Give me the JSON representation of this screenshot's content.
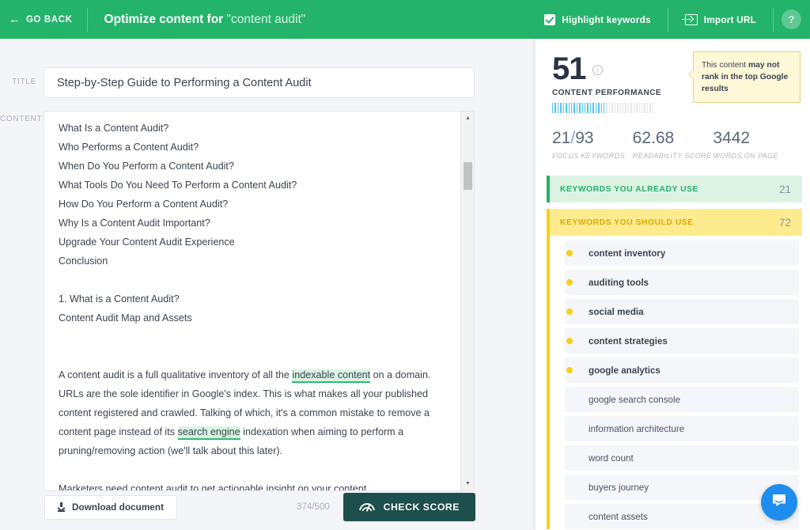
{
  "header": {
    "go_back": "GO BACK",
    "back_icon": "arrow-left-icon",
    "title_prefix": "Optimize content for",
    "title_keyword": "\"content audit\"",
    "highlight_keywords": "Highlight keywords",
    "highlight_checked": true,
    "import_url": "Import URL",
    "help": "?",
    "accent": "#23b36b"
  },
  "editor": {
    "title_label": "TITLE",
    "title_value": "Step-by-Step Guide to Performing a Content Audit",
    "content_label": "CONTENT",
    "lines": [
      "What Is a Content Audit?",
      "Who Performs a Content Audit?",
      "When Do You Perform a Content Audit?",
      "What Tools Do You Need To Perform a Content Audit?",
      "How Do You Perform a Content Audit?",
      "Why Is a Content Audit Important?",
      "Upgrade Your Content Audit Experience",
      "Conclusion"
    ],
    "lines2": [
      "1. What is a Content Audit?",
      "Content Audit Map and Assets"
    ],
    "para1_a": "A content audit is a full qualitative inventory of all the ",
    "para1_hl1": "indexable content",
    "para1_b": " on a domain. URLs are the sole identifier in Google's index. This is what makes all your published content registered and crawled. Talking of which, it's a common mistake to remove a content page instead of its ",
    "para1_hl2": "search engine",
    "para1_c": " indexation when aiming to perform a pruning/removing action (we'll talk about this later).",
    "para2": "Marketers need content audit to get actionable insight on your content",
    "download_label": "Download document",
    "char_count": "374/500",
    "check_score_label": "CHECK SCORE"
  },
  "panel": {
    "score": "51",
    "score_caption": "CONTENT PERFORMANCE",
    "gauge_total": 38,
    "gauge_filled": 20,
    "gauge_color": "#4fc3f7",
    "tooltip_plain": "This content ",
    "tooltip_bold": "may not rank in the top Google results",
    "stats": [
      {
        "value": "21/93",
        "label": "FOCUS KEYWORDS"
      },
      {
        "value": "62.68",
        "label": "READABILITY SCORE"
      },
      {
        "value": "3442",
        "label": "WORDS ON PAGE"
      }
    ],
    "section_already": {
      "label": "KEYWORDS YOU ALREADY USE",
      "count": "21",
      "color": "#27b06b"
    },
    "section_should": {
      "label": "KEYWORDS YOU SHOULD USE",
      "count": "72",
      "color": "#e0a800"
    },
    "keywords": [
      {
        "text": "content inventory",
        "dot": true
      },
      {
        "text": "auditing tools",
        "dot": true
      },
      {
        "text": "social media",
        "dot": true
      },
      {
        "text": "content strategies",
        "dot": true
      },
      {
        "text": "google analytics",
        "dot": true
      },
      {
        "text": "google search console",
        "dot": false
      },
      {
        "text": "information architecture",
        "dot": false
      },
      {
        "text": "word count",
        "dot": false
      },
      {
        "text": "buyers journey",
        "dot": false
      },
      {
        "text": "content assets",
        "dot": false
      }
    ]
  }
}
